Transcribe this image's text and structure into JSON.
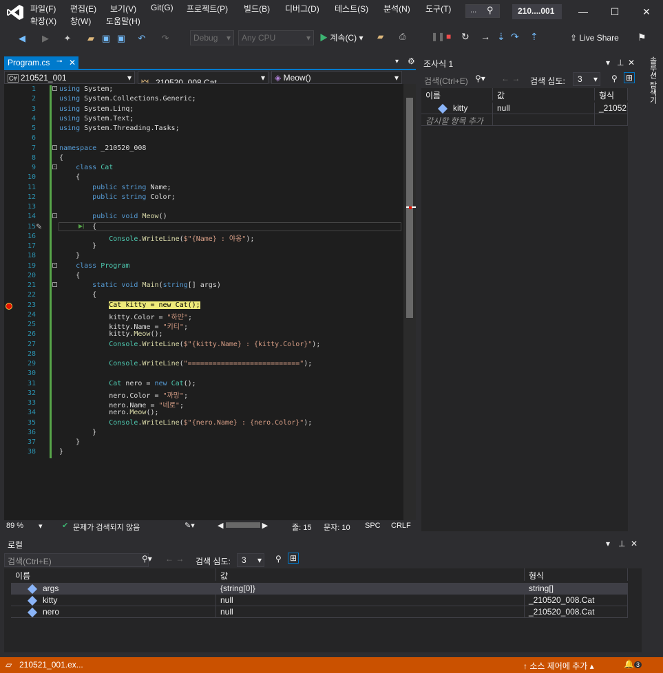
{
  "menu": [
    "파일(F)",
    "편집(E)",
    "보기(V)",
    "Git(G)",
    "프로젝트(P)",
    "빌드(B)",
    "디버그(D)",
    "테스트(S)",
    "분석(N)",
    "도구(T)",
    "확장(X)",
    "창(W)",
    "도움말(H)"
  ],
  "window": {
    "solution_title": "210....001",
    "search_ellipsis": "..."
  },
  "toolbar": {
    "config": "Debug",
    "platform": "Any CPU",
    "continue": "계속(C)",
    "live_share": "Live Share"
  },
  "editor": {
    "tab": "Program.cs",
    "nav_project": "210521_001",
    "nav_class": "_210520_008.Cat",
    "nav_member": "Meow()",
    "zoom": "89 %",
    "issues": "문제가 검색되지 않음",
    "line": "줄: 15",
    "col": "문자: 10",
    "spc": "SPC",
    "crlf": "CRLF",
    "lines": [
      "using System;",
      "using System.Collections.Generic;",
      "using System.Linq;",
      "using System.Text;",
      "using System.Threading.Tasks;",
      "",
      "namespace _210520_008",
      "{",
      "    class Cat",
      "    {",
      "        public string Name;",
      "        public string Color;",
      "",
      "        public void Meow()",
      "        {",
      "            Console.WriteLine($\"{Name} : 야옹\");",
      "        }",
      "    }",
      "    class Program",
      "    {",
      "        static void Main(string[] args)",
      "        {",
      "            Cat kitty = new Cat();",
      "            kitty.Color = \"하얀\";",
      "            kitty.Name = \"키티\";",
      "            kitty.Meow();",
      "            Console.WriteLine($\"{kitty.Name} : {kitty.Color}\");",
      "",
      "            Console.WriteLine(\"===========================\");",
      "",
      "            Cat nero = new Cat();",
      "            nero.Color = \"까망\";",
      "            nero.Name = \"네로\";",
      "            nero.Meow();",
      "            Console.WriteLine($\"{nero.Name} : {nero.Color}\");",
      "        }",
      "    }",
      "}"
    ]
  },
  "watch": {
    "title": "조사식 1",
    "search_placeholder": "검색(Ctrl+E)",
    "depth_label": "검색 심도:",
    "depth": "3",
    "columns": [
      "이름",
      "값",
      "형식"
    ],
    "rows": [
      {
        "name": "kitty",
        "value": "null",
        "type": "_21052..."
      }
    ],
    "add_hint": "감시할 항목 추가"
  },
  "locals": {
    "title": "로컬",
    "search_placeholder": "검색(Ctrl+E)",
    "depth_label": "검색 심도:",
    "depth": "3",
    "columns": [
      "이름",
      "값",
      "형식"
    ],
    "rows": [
      {
        "name": "args",
        "value": "{string[0]}",
        "type": "string[]"
      },
      {
        "name": "kitty",
        "value": "null",
        "type": "_210520_008.Cat"
      },
      {
        "name": "nero",
        "value": "null",
        "type": "_210520_008.Cat"
      }
    ]
  },
  "sidebar": {
    "label": "솔루션 탐색기"
  },
  "status": {
    "process": "210521_001.ex...",
    "source_control": "소스 제어에 추가",
    "notifications": "3"
  },
  "colors": {
    "accent": "#007acc",
    "status": "#ca5100"
  }
}
